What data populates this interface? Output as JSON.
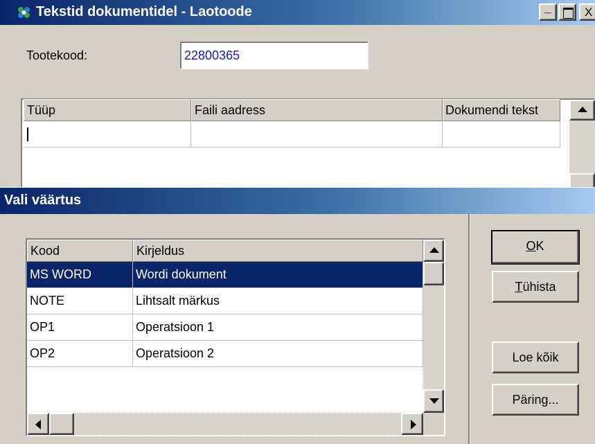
{
  "main_window": {
    "title": "Tekstid dokumentidel - Laotoode",
    "product_code_label": "Tootekood:",
    "product_code_value": "22800365",
    "grid_headers": [
      "Tüüp",
      "Faili aadress",
      "Dokumendi tekst"
    ],
    "title_buttons": [
      "_",
      "□",
      "X"
    ]
  },
  "dialog": {
    "title": "Vali väärtus",
    "columns": [
      "Kood",
      "Kirjeldus"
    ],
    "rows": [
      {
        "code": "MS WORD",
        "description": "Wordi dokument",
        "selected": true
      },
      {
        "code": "NOTE",
        "description": "Lihtsalt märkus",
        "selected": false
      },
      {
        "code": "OP1",
        "description": "Operatsioon 1",
        "selected": false
      },
      {
        "code": "OP2",
        "description": "Operatsioon 2",
        "selected": false
      }
    ],
    "buttons": {
      "ok": {
        "mnemonic": "O",
        "rest": "K"
      },
      "cancel": {
        "mnemonic": "T",
        "rest": "ühista"
      },
      "read_all": "Loe kõik",
      "query": "Päring..."
    }
  },
  "colors": {
    "title_active": "#0a246a",
    "selection": "#0a246a",
    "face": "#d4d0c8"
  }
}
